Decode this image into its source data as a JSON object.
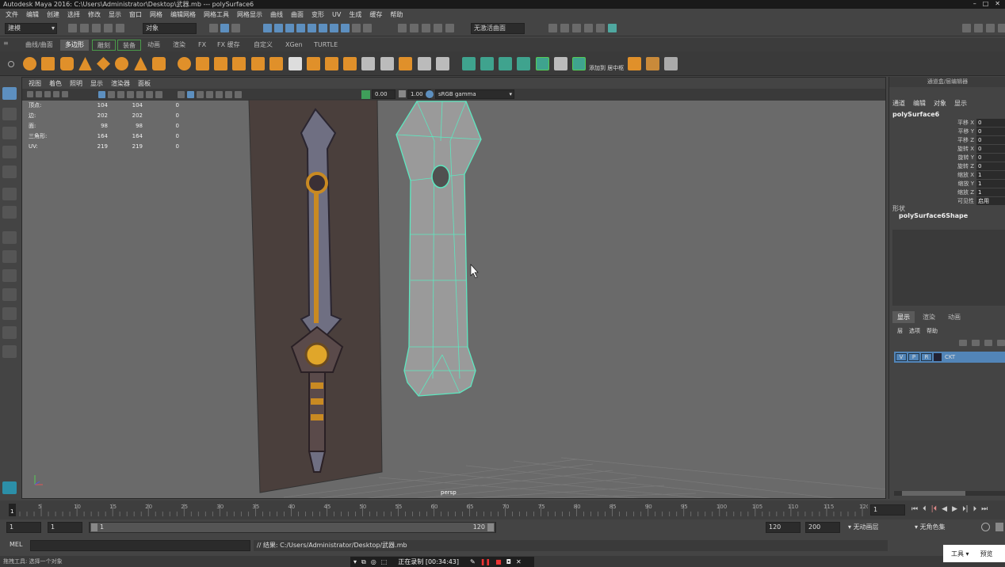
{
  "title": "Autodesk Maya 2016: C:\\Users\\Administrator\\Desktop\\武器.mb   ---   polySurface6",
  "menu": [
    "文件",
    "编辑",
    "创建",
    "选择",
    "修改",
    "显示",
    "窗口",
    "网格",
    "编辑网格",
    "网格工具",
    "网格显示",
    "曲线",
    "曲面",
    "变形",
    "UV",
    "生成",
    "缓存",
    "帮助"
  ],
  "status": {
    "mode": "建模",
    "objects": "对象",
    "live_surface": "无激活曲面"
  },
  "shelf_tabs": [
    "曲线/曲面",
    "多边形",
    "雕刻",
    "装备",
    "动画",
    "渲染",
    "FX",
    "FX 缓存",
    "自定义",
    "XGen",
    "TURTLE"
  ],
  "shelf_active": "多边形",
  "shelf_label": "添加到 居中枢",
  "viewport": {
    "menu": [
      "视图",
      "着色",
      "照明",
      "显示",
      "渲染器",
      "面板"
    ],
    "exposure": "0.00",
    "gamma": "1.00",
    "colorspace": "sRGB gamma",
    "camera": "persp",
    "hud": [
      {
        "label": "顶点:",
        "a": "104",
        "b": "104",
        "c": "0"
      },
      {
        "label": "边:",
        "a": "202",
        "b": "202",
        "c": "0"
      },
      {
        "label": "面:",
        "a": "98",
        "b": "98",
        "c": "0"
      },
      {
        "label": "三角形:",
        "a": "164",
        "b": "164",
        "c": "0"
      },
      {
        "label": "UV:",
        "a": "219",
        "b": "219",
        "c": "0"
      }
    ]
  },
  "channel_box": {
    "header": "通道盒/层编辑器",
    "menu": [
      "通道",
      "编辑",
      "对象",
      "显示"
    ],
    "object": "polySurface6",
    "attrs": [
      {
        "label": "平移 X",
        "value": "0"
      },
      {
        "label": "平移 Y",
        "value": "0"
      },
      {
        "label": "平移 Z",
        "value": "0"
      },
      {
        "label": "旋转 X",
        "value": "0"
      },
      {
        "label": "旋转 Y",
        "value": "0"
      },
      {
        "label": "旋转 Z",
        "value": "0"
      },
      {
        "label": "缩放 X",
        "value": "1"
      },
      {
        "label": "缩放 Y",
        "value": "1"
      },
      {
        "label": "缩放 Z",
        "value": "1"
      },
      {
        "label": "可见性",
        "value": "启用"
      }
    ],
    "shape_header": "形状",
    "shape": "polySurface6Shape",
    "layer_tabs": [
      "显示",
      "渲染",
      "动画"
    ],
    "layer_menu": [
      "层",
      "选项",
      "帮助"
    ],
    "layer": {
      "v": "V",
      "p": "P",
      "r": "R",
      "name": "CKT"
    }
  },
  "timeline": {
    "ticks": [
      "1",
      "5",
      "10",
      "15",
      "20",
      "25",
      "30",
      "35",
      "40",
      "45",
      "50",
      "55",
      "60",
      "65",
      "70",
      "75",
      "80",
      "85",
      "90",
      "95",
      "100",
      "105",
      "110",
      "115",
      "120"
    ],
    "current": "1"
  },
  "range": {
    "start": "1",
    "inner_start": "1",
    "slider_start": "1",
    "slider_end": "120",
    "end": "120",
    "max": "200",
    "anim_layer": "无动画层",
    "char_set": "无角色集"
  },
  "cmd": {
    "label": "MEL",
    "result": "// 结果: C:/Users/Administrator/Desktop/武器.mb"
  },
  "help": "拖拽工具: 选择一个对象",
  "recording": {
    "status": "正在录制 [00:34:43]"
  },
  "float_menu": {
    "tools": "工具 ▾",
    "preview": "预览"
  }
}
